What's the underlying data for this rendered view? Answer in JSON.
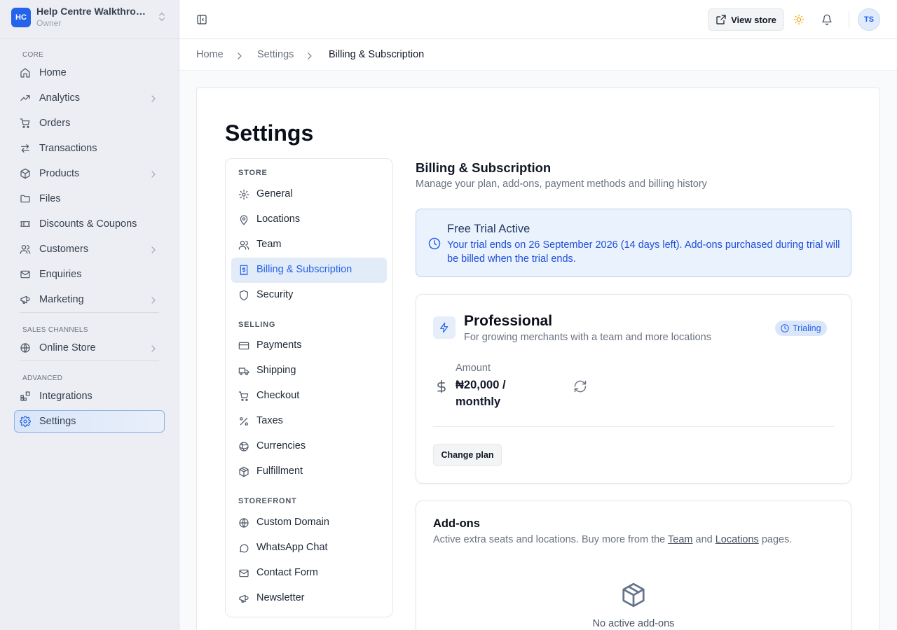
{
  "workspace": {
    "initials": "HC",
    "name": "Help Centre Walkthrough",
    "role": "Owner"
  },
  "sidebar": {
    "sections": [
      {
        "label": "CORE"
      },
      {
        "label": "SALES CHANNELS"
      },
      {
        "label": "ADVANCED"
      }
    ],
    "items": [
      {
        "label": "Home",
        "icon": "home-icon"
      },
      {
        "label": "Analytics",
        "icon": "trend-icon"
      },
      {
        "label": "Orders",
        "icon": "cart-icon"
      },
      {
        "label": "Transactions",
        "icon": "arrows-icon"
      },
      {
        "label": "Products",
        "icon": "box-icon"
      },
      {
        "label": "Files",
        "icon": "folder-icon"
      },
      {
        "label": "Discounts & Coupons",
        "icon": "ticket-icon"
      },
      {
        "label": "Customers",
        "icon": "users-icon"
      },
      {
        "label": "Enquiries",
        "icon": "mail-icon"
      },
      {
        "label": "Marketing",
        "icon": "megaphone-icon"
      },
      {
        "label": "Online Store",
        "icon": "globe-icon"
      },
      {
        "label": "Integrations",
        "icon": "blocks-icon"
      },
      {
        "label": "Settings",
        "icon": "gear-icon",
        "active": true
      }
    ]
  },
  "topbar": {
    "view_store_label": "View store",
    "avatar_initials": "TS"
  },
  "breadcrumb": [
    "Home",
    "Settings",
    "Billing & Subscription"
  ],
  "page": {
    "title": "Settings"
  },
  "settings_nav": {
    "sections": [
      "STORE",
      "SELLING",
      "STOREFRONT"
    ],
    "items": [
      {
        "label": "General",
        "icon": "gear-icon"
      },
      {
        "label": "Locations",
        "icon": "map-pin-icon"
      },
      {
        "label": "Team",
        "icon": "users-icon"
      },
      {
        "label": "Billing & Subscription",
        "icon": "receipt-icon",
        "active": true
      },
      {
        "label": "Security",
        "icon": "shield-icon"
      },
      {
        "label": "Payments",
        "icon": "credit-card-icon"
      },
      {
        "label": "Shipping",
        "icon": "truck-icon"
      },
      {
        "label": "Checkout",
        "icon": "cart-icon"
      },
      {
        "label": "Taxes",
        "icon": "percent-icon"
      },
      {
        "label": "Currencies",
        "icon": "coins-icon"
      },
      {
        "label": "Fulfillment",
        "icon": "package-icon"
      },
      {
        "label": "Custom Domain",
        "icon": "globe-icon"
      },
      {
        "label": "WhatsApp Chat",
        "icon": "chat-icon"
      },
      {
        "label": "Contact Form",
        "icon": "mail-icon"
      },
      {
        "label": "Newsletter",
        "icon": "megaphone-icon"
      }
    ]
  },
  "billing": {
    "title": "Billing & Subscription",
    "subtitle": "Manage your plan, add-ons, payment methods and billing history",
    "trial": {
      "title": "Free Trial Active",
      "text": "Your trial ends on 26 September 2026 (14 days left). Add-ons purchased during trial will be billed when the trial ends."
    },
    "plan": {
      "name": "Professional",
      "description": "For growing merchants with a team and more locations",
      "status": "Trialing",
      "amount_label": "Amount",
      "amount_value": "₦20,000 / monthly",
      "change_plan_label": "Change plan"
    },
    "addons": {
      "title": "Add-ons",
      "subtitle_before": "Active extra seats and locations. Buy more from the ",
      "team_link": "Team",
      "subtitle_and": " and ",
      "locations_link": "Locations",
      "subtitle_after": " pages.",
      "empty_text": "No active add-ons"
    }
  },
  "colors": {
    "accent": "#2563eb",
    "trial_bg": "#eaf2fd",
    "sidebar_bg": "#eceef3"
  }
}
